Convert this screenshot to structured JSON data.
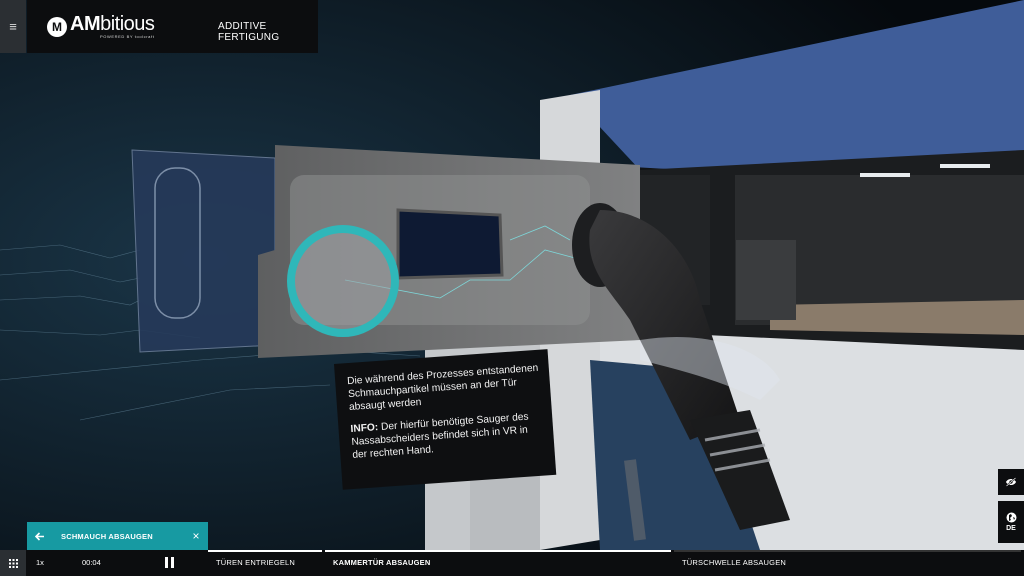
{
  "header": {
    "menu_icon": "hamburger-icon",
    "logo": {
      "main": "AM",
      "rest": "bitious",
      "sub": "POWERED BY toolcraft"
    },
    "section_title": "ADDITIVE FERTIGUNG"
  },
  "info_box": {
    "text": "Die während des Prozesses entstandenen Schmauchpartikel müssen an der Tür absaugt werden",
    "info_label": "INFO:",
    "info_text": " Der hierfür benötigte Sauger des Nassabscheiders befindet sich in VR in der rechten Hand."
  },
  "side_controls": {
    "visibility_icon": "eye-off-icon",
    "language_icon": "globe-icon",
    "language": "DE"
  },
  "step_card": {
    "title": "SCHMAUCH ABSAUGEN",
    "back_icon": "arrow-left-icon",
    "close_label": "×"
  },
  "player": {
    "speed": "1x",
    "time": "00:04",
    "state": "playing"
  },
  "timeline": {
    "segments": [
      {
        "label": "TÜREN ENTRIEGELN",
        "progress": 1.0
      },
      {
        "label": "KAMMERTÜR ABSAUGEN",
        "progress": 1.0,
        "active": true
      },
      {
        "label": "TÜRSCHWELLE ABSAUGEN",
        "progress": 0.0
      }
    ]
  },
  "colors": {
    "accent": "#179aa2",
    "panel": "#0c0d0f",
    "highlight_ring": "#2fb7b9"
  }
}
